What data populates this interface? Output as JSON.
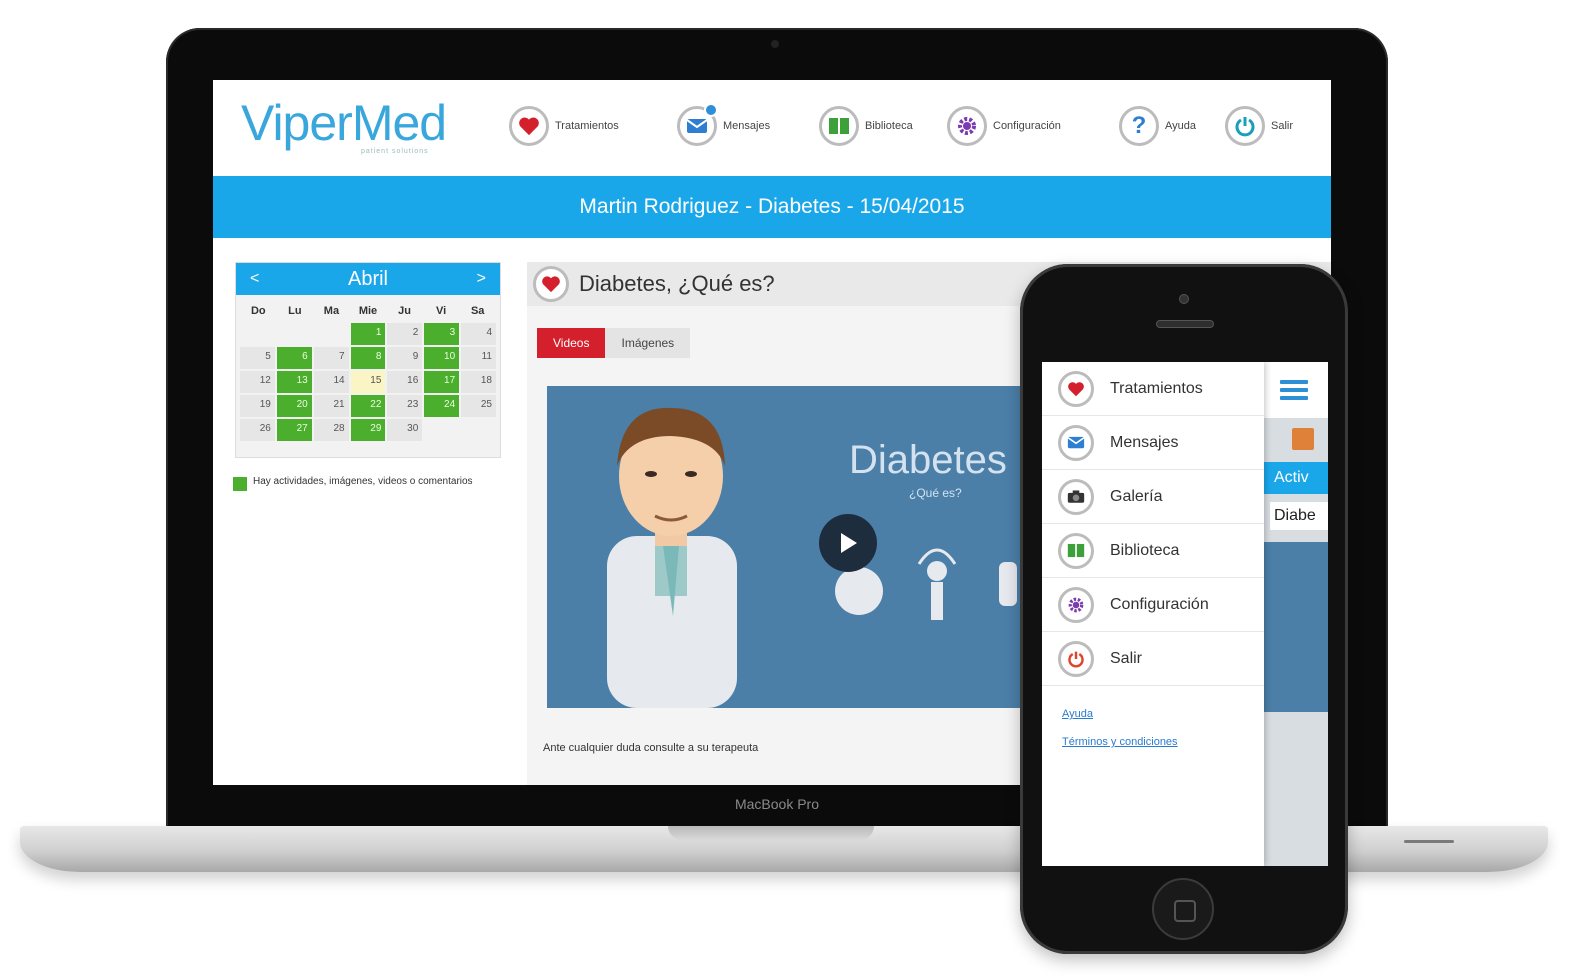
{
  "device_label": "MacBook Pro",
  "app": {
    "logo": "ViperMed",
    "logo_tagline": "patient solutions",
    "nav": [
      {
        "label": "Tratamientos",
        "icon": "heart-icon"
      },
      {
        "label": "Mensajes",
        "icon": "envelope-icon"
      },
      {
        "label": "Biblioteca",
        "icon": "book-icon"
      },
      {
        "label": "Configuración",
        "icon": "gear-icon"
      },
      {
        "label": "Ayuda",
        "icon": "question-icon"
      },
      {
        "label": "Salir",
        "icon": "power-icon"
      }
    ],
    "banner": "Martin Rodriguez - Diabetes - 15/04/2015"
  },
  "calendar": {
    "month": "Abril",
    "prev": "<",
    "next": ">",
    "weekdays": [
      "Do",
      "Lu",
      "Ma",
      "Mie",
      "Ju",
      "Vi",
      "Sa"
    ],
    "days": [
      "",
      "",
      "",
      "1",
      "2",
      "3",
      "4",
      "5",
      "6",
      "7",
      "8",
      "9",
      "10",
      "11",
      "12",
      "13",
      "14",
      "15",
      "16",
      "17",
      "18",
      "19",
      "20",
      "21",
      "22",
      "23",
      "24",
      "25",
      "26",
      "27",
      "28",
      "29",
      "30",
      "",
      ""
    ],
    "active_days": [
      1,
      3,
      6,
      8,
      10,
      13,
      17,
      20,
      22,
      24,
      27,
      29
    ],
    "today": 15,
    "legend": "Hay actividades, imágenes, videos o comentarios"
  },
  "content": {
    "title": "Diabetes, ¿Qué es?",
    "tabs": [
      "Videos",
      "Imágenes"
    ],
    "active_tab": "Videos",
    "video_title": "Diabetes",
    "video_subtitle": "¿Qué es?",
    "disclaimer": "Ante cualquier duda consulte a su terapeuta"
  },
  "mobile": {
    "menu": [
      {
        "label": "Tratamientos",
        "icon": "heart-icon"
      },
      {
        "label": "Mensajes",
        "icon": "envelope-icon"
      },
      {
        "label": "Galería",
        "icon": "camera-icon"
      },
      {
        "label": "Biblioteca",
        "icon": "book-icon"
      },
      {
        "label": "Configuración",
        "icon": "gear-icon"
      },
      {
        "label": "Salir",
        "icon": "power-icon"
      }
    ],
    "links": [
      "Ayuda",
      "Términos y condiciones"
    ],
    "behind_bar": "Activ",
    "behind_field": "Diabe"
  },
  "colors": {
    "accent": "#1aa7ea",
    "active_day": "#4cae2d",
    "tab_active": "#d4202c",
    "logo": "#3aa7dc"
  }
}
